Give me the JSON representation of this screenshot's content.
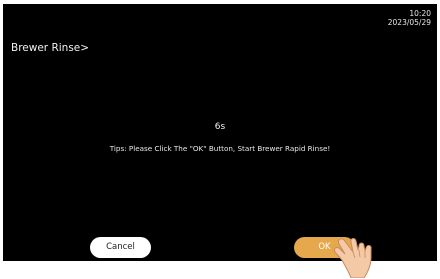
{
  "status_bar": {
    "time": "10:20",
    "date": "2023/05/29"
  },
  "header": {
    "title": "Brewer Rinse>"
  },
  "main": {
    "countdown": "6s",
    "tips": "Tips: Please Click The \"OK\" Button, Start Brewer Rapid Rinse!"
  },
  "buttons": {
    "cancel_label": "Cancel",
    "ok_label": "OK"
  },
  "colors": {
    "background": "#000000",
    "ok_button": "#e6a84c",
    "cancel_button": "#ffffff"
  },
  "icons": {
    "pointer": "hand-pointer-icon"
  }
}
